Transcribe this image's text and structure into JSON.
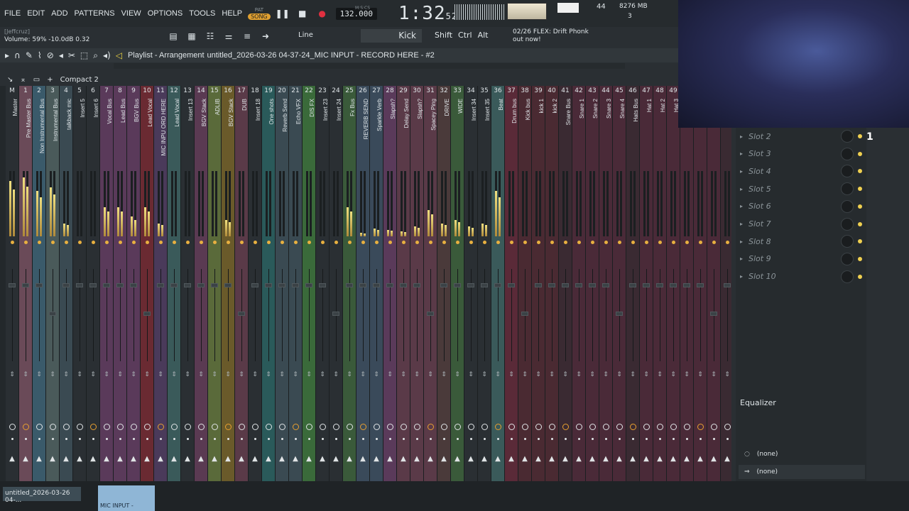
{
  "menu": [
    "FILE",
    "EDIT",
    "ADD",
    "PATTERNS",
    "VIEW",
    "OPTIONS",
    "TOOLS",
    "HELP"
  ],
  "transport": {
    "pat": "PAT",
    "song": "SONG",
    "tempo": "132.000",
    "time_main": "1:32",
    "time_sub": "52",
    "msc": "M:S:CS"
  },
  "perf": {
    "cpu_value": "44",
    "mem": "8276 MB",
    "voices": "3"
  },
  "hint": {
    "user": "[Jeffcruz]",
    "volume": "Volume: 59%  -10.0dB  0.32"
  },
  "toolbar2": {
    "snap": "Line",
    "channel": "Kick",
    "mod_shift": "Shift",
    "mod_ctrl": "Ctrl",
    "mod_alt": "Alt",
    "notif_count": "02/26",
    "notif_text": "FLEX: Drift Phonk out now!"
  },
  "playlist": {
    "title": "Playlist - Arrangement",
    "file": "untitled_2026-03-26 04-37-24_MIC INPUT - RECORD HERE - #2"
  },
  "mixer": {
    "view": "Compact 2",
    "strips": [
      {
        "num": "M",
        "name": "Master",
        "color": "#2a2f33",
        "level": 0.85
      },
      {
        "num": "1",
        "name": "Pre Master Bus",
        "color": "#6a4a58",
        "level": 0.9
      },
      {
        "num": "2",
        "name": "Non Instrumental Bus",
        "color": "#3a5a6a",
        "level": 0.7
      },
      {
        "num": "3",
        "name": "Instrumental Bus",
        "color": "#4a5a5a",
        "level": 0.75
      },
      {
        "num": "4",
        "name": "talkback mic",
        "color": "#3a4a52",
        "level": 0.2
      },
      {
        "num": "5",
        "name": "Insert 5",
        "color": "#2a2f33",
        "level": 0
      },
      {
        "num": "6",
        "name": "Insert 6",
        "color": "#2a2f33",
        "level": 0
      },
      {
        "num": "7",
        "name": "Vocal Bus",
        "color": "#5a3a5a",
        "level": 0.45
      },
      {
        "num": "8",
        "name": "Lead Bus",
        "color": "#5a3a5a",
        "level": 0.45
      },
      {
        "num": "9",
        "name": "BGV Bus",
        "color": "#5a3a5a",
        "level": 0.3
      },
      {
        "num": "10",
        "name": "Lead Vocal",
        "color": "#6a2a32",
        "level": 0.45
      },
      {
        "num": "11",
        "name": "MIC INPU ORD HERE",
        "color": "#4a3a5a",
        "level": 0.2
      },
      {
        "num": "12",
        "name": "Lead Vocal",
        "color": "#3a5a5a",
        "level": 0
      },
      {
        "num": "13",
        "name": "Insert 13",
        "color": "#2a2f33",
        "level": 0
      },
      {
        "num": "14",
        "name": "BGV Stack",
        "color": "#5a3a52",
        "level": 0
      },
      {
        "num": "15",
        "name": "ADLIB",
        "color": "#5a6a3a",
        "level": 0
      },
      {
        "num": "16",
        "name": "BGV Stack",
        "color": "#6a5a2a",
        "level": 0.25
      },
      {
        "num": "17",
        "name": "DUB",
        "color": "#5a3a48",
        "level": 0
      },
      {
        "num": "18",
        "name": "Insert 18",
        "color": "#2a2f33",
        "level": 0
      },
      {
        "num": "19",
        "name": "One shots",
        "color": "#2a5a5a",
        "level": 0
      },
      {
        "num": "20",
        "name": "Reverb Send",
        "color": "#3a4a52",
        "level": 0
      },
      {
        "num": "21",
        "name": "Echo VFX",
        "color": "#3a4a52",
        "level": 0
      },
      {
        "num": "22",
        "name": "DIS FX",
        "color": "#3a6a3a",
        "level": 0
      },
      {
        "num": "23",
        "name": "Insert 23",
        "color": "#2a2f33",
        "level": 0
      },
      {
        "num": "24",
        "name": "Insert 24",
        "color": "#2a2f33",
        "level": 0
      },
      {
        "num": "25",
        "name": "Fx Bus",
        "color": "#3a5a3a",
        "level": 0.45
      },
      {
        "num": "26",
        "name": "REVERB SEND",
        "color": "#3a4a5a",
        "level": 0.05
      },
      {
        "num": "27",
        "name": "Sparkle Verb",
        "color": "#3a4a5a",
        "level": 0.12
      },
      {
        "num": "28",
        "name": "Slapsh?",
        "color": "#5a3a5a",
        "level": 0.1
      },
      {
        "num": "29",
        "name": "Delay Send",
        "color": "#5a3a48",
        "level": 0.08
      },
      {
        "num": "30",
        "name": "Slapsh?",
        "color": "#5a3a48",
        "level": 0.15
      },
      {
        "num": "31",
        "name": "Spacey Ping",
        "color": "#5a3a48",
        "level": 0.4
      },
      {
        "num": "32",
        "name": "DRIVE",
        "color": "#4a3a3a",
        "level": 0.2
      },
      {
        "num": "33",
        "name": "WIDE",
        "color": "#3a5a3a",
        "level": 0.25
      },
      {
        "num": "34",
        "name": "Insert 34",
        "color": "#2a2f33",
        "level": 0.15
      },
      {
        "num": "35",
        "name": "Insert 35",
        "color": "#2a2f33",
        "level": 0.2
      },
      {
        "num": "36",
        "name": "Beat",
        "color": "#3a5a5a",
        "level": 0.7
      },
      {
        "num": "37",
        "name": "Drum bus",
        "color": "#5a2a38",
        "level": 0
      },
      {
        "num": "38",
        "name": "Kick bus",
        "color": "#4a2a32",
        "level": 0
      },
      {
        "num": "39",
        "name": "kick 1",
        "color": "#4a2a32",
        "level": 0
      },
      {
        "num": "40",
        "name": "kick 2",
        "color": "#4a2a32",
        "level": 0
      },
      {
        "num": "41",
        "name": "Snare Bus",
        "color": "#3a2a32",
        "level": 0
      },
      {
        "num": "42",
        "name": "Snare 1",
        "color": "#4a2a38",
        "level": 0
      },
      {
        "num": "43",
        "name": "Snare 2",
        "color": "#4a2a38",
        "level": 0
      },
      {
        "num": "44",
        "name": "Snare 3",
        "color": "#4a2a38",
        "level": 0
      },
      {
        "num": "45",
        "name": "Snare 4",
        "color": "#4a2a38",
        "level": 0
      },
      {
        "num": "46",
        "name": "Hats Bus",
        "color": "#3a2a32",
        "level": 0
      },
      {
        "num": "47",
        "name": "Hat 1",
        "color": "#4a2a38",
        "level": 0
      },
      {
        "num": "48",
        "name": "Hat 2",
        "color": "#4a2a38",
        "level": 0
      },
      {
        "num": "49",
        "name": "Hat 3",
        "color": "#4a2a38",
        "level": 0
      },
      {
        "num": "",
        "name": "OH 1",
        "color": "#4a2a38",
        "level": 0
      },
      {
        "num": "",
        "name": "OH 2",
        "color": "#4a2a38",
        "level": 0
      },
      {
        "num": "",
        "name": "OH 3",
        "color": "#4a2a38",
        "level": 0
      },
      {
        "num": "",
        "name": "Perc Bus",
        "color": "#3a2a32",
        "level": 0
      }
    ]
  },
  "slots": [
    "Slot 2",
    "Slot 3",
    "Slot 4",
    "Slot 5",
    "Slot 6",
    "Slot 7",
    "Slot 8",
    "Slot 9",
    "Slot 10"
  ],
  "effects": {
    "eq": "Equalizer",
    "none1": "(none)",
    "none2": "(none)"
  },
  "bottom": {
    "tab1": "untitled_2026-03-26 04-...",
    "tab2": "MIC INPUT -"
  },
  "twitch_count": "1"
}
